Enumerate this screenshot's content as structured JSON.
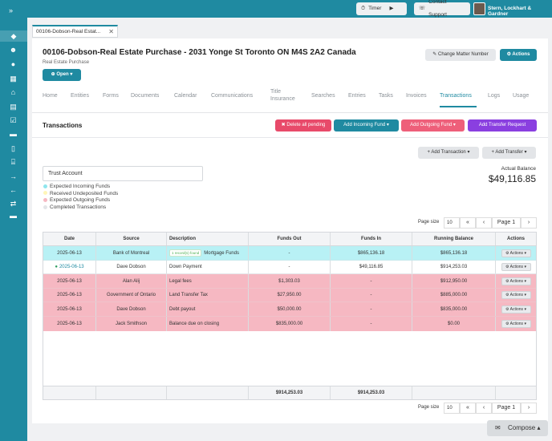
{
  "topbar": {
    "timer_label": "Timer",
    "support_label": "Contact Support",
    "firm_name": "Stern, Lockhart & Gardner"
  },
  "doc_tab": {
    "label": "00106-Dobson-Real Estat..."
  },
  "matter": {
    "title": "00106-Dobson-Real Estate Purchase - 2031 Yonge St Toronto ON M4S 2A2 Canada",
    "subtitle": "Real Estate Purchase",
    "status_label": "Open",
    "change_number_label": "Change Matter Number",
    "actions_label": "Actions"
  },
  "tabs": [
    "Home",
    "Entities",
    "Forms",
    "Documents",
    "Calendar",
    "Communications",
    "Title Insurance",
    "Searches",
    "Entries",
    "Tasks",
    "Invoices",
    "Transactions",
    "Logs",
    "Usage"
  ],
  "transactions": {
    "title": "Transactions",
    "delete_label": "Delete all pending",
    "add_incoming_label": "Add Incoming Fund",
    "add_outgoing_label": "Add Outgoing Fund",
    "add_transfer_request_label": "Add Transfer Request",
    "add_transaction_label": "Add Transaction",
    "add_transfer_label": "Add Transfer",
    "account": "Trust Account",
    "legend": [
      "Expected Incoming Funds",
      "Received Undeposited Funds",
      "Expected Outgoing Funds",
      "Completed Transactions"
    ],
    "balance_label": "Actual Balance",
    "balance_value": "$49,116.85",
    "page_size_label": "Page size",
    "page_size": "10",
    "page_label": "Page 1",
    "columns": [
      "Date",
      "Source",
      "Description",
      "Funds Out",
      "Funds In",
      "Running Balance",
      "Actions"
    ],
    "rows": [
      {
        "date": "2025-06-13",
        "source": "Bank of Montreal",
        "badge": "1 record(s) found",
        "description": "Mortgage Funds",
        "out": "-",
        "in": "$865,136.18",
        "balance": "$865,136.18",
        "action": "Actions"
      },
      {
        "date": "2025-06-13",
        "source": "Dave Dobson",
        "badge": "",
        "description": "Down Payment",
        "out": "-",
        "in": "$49,116.85",
        "balance": "$914,253.03",
        "action": "Actions"
      },
      {
        "date": "2025-06-13",
        "source": "Alan Alij",
        "badge": "",
        "description": "Legal fees",
        "out": "$1,303.03",
        "in": "-",
        "balance": "$912,950.00",
        "action": "Actions"
      },
      {
        "date": "2025-06-13",
        "source": "Government of Ontario",
        "badge": "",
        "description": "Land Transfer Tax",
        "out": "$27,950.00",
        "in": "-",
        "balance": "$885,000.00",
        "action": "Actions"
      },
      {
        "date": "2025-06-13",
        "source": "Dave Dobson",
        "badge": "",
        "description": "Debt payout",
        "out": "$50,000.00",
        "in": "-",
        "balance": "$835,000.00",
        "action": "Actions"
      },
      {
        "date": "2025-06-13",
        "source": "Jack Smithson",
        "badge": "",
        "description": "Balance due on closing",
        "out": "$835,000.00",
        "in": "-",
        "balance": "$0.00",
        "action": "Actions"
      }
    ],
    "totals": {
      "out": "$914,253.03",
      "in": "$914,253.03"
    }
  },
  "compose_label": "Compose",
  "colors": {
    "brand": "#1f8aa1",
    "incoming_row": "#b8f1f5",
    "outgoing_row": "#f6b8c2",
    "delete": "#e84a6a",
    "outgoing_btn": "#ee5f7a",
    "transfer_btn": "#8a3fe0"
  }
}
